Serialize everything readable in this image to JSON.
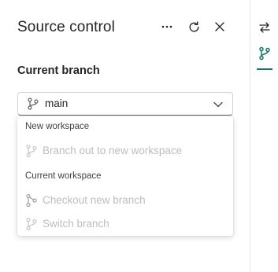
{
  "header": {
    "title": "Source control",
    "more_icon": "more-horizontal-icon",
    "refresh_icon": "refresh-icon",
    "close_icon": "close-icon"
  },
  "current_branch": {
    "label": "Current branch",
    "selected": "main",
    "icon": "branch-icon"
  },
  "dropdown": {
    "groups": [
      {
        "label": "New workspace",
        "items": [
          {
            "label": "Branch out to new workspace",
            "disabled": true
          }
        ]
      },
      {
        "label": "Current workspace",
        "items": [
          {
            "label": "Checkout new branch",
            "disabled": true
          },
          {
            "label": "Switch branch",
            "disabled": true
          }
        ]
      }
    ]
  },
  "rail": {
    "items": [
      "swap-arrows-icon",
      "branch-icon"
    ],
    "active_color": "#117865"
  }
}
